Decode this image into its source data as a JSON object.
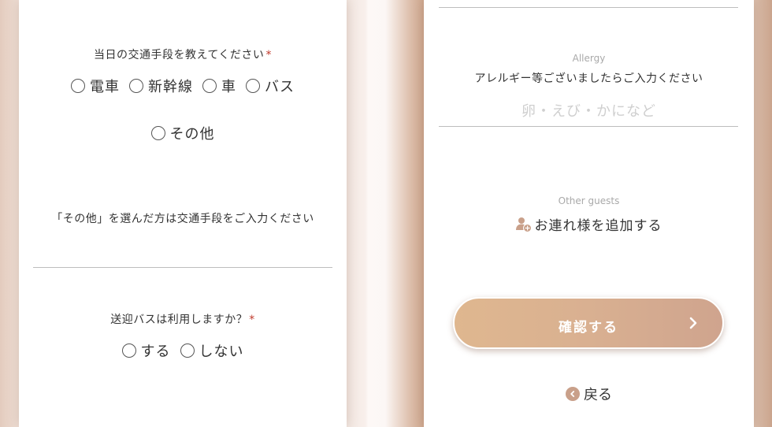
{
  "colors": {
    "accent": "#d4ab90",
    "required": "#c0392b",
    "text": "#333333",
    "muted": "#a9a9a9",
    "placeholder": "#cfcfcf"
  },
  "left_card": {
    "transport": {
      "label": "当日の交通手段を教えてください",
      "required_mark": "*",
      "options": [
        "電車",
        "新幹線",
        "車",
        "バス",
        "その他"
      ]
    },
    "other_transport": {
      "label": "「その他」を選んだ方は交通手段をご入力ください",
      "value": ""
    },
    "shuttle_bus": {
      "label": "送迎バスは利用しますか？",
      "required_mark": "*",
      "options": [
        "する",
        "しない"
      ]
    }
  },
  "right_card": {
    "allergy": {
      "small_label": "Allergy",
      "label": "アレルギー等ございましたらご入力ください",
      "placeholder": "卵・えび・かになど"
    },
    "guests": {
      "small_label": "Other guests",
      "add_label": "お連れ様を追加する",
      "icon": "add-person-icon"
    },
    "confirm_button": {
      "label": "確認する",
      "icon": "chevron-right-icon"
    },
    "back_link": {
      "label": "戻る",
      "icon": "chevron-left-circle-icon"
    }
  }
}
